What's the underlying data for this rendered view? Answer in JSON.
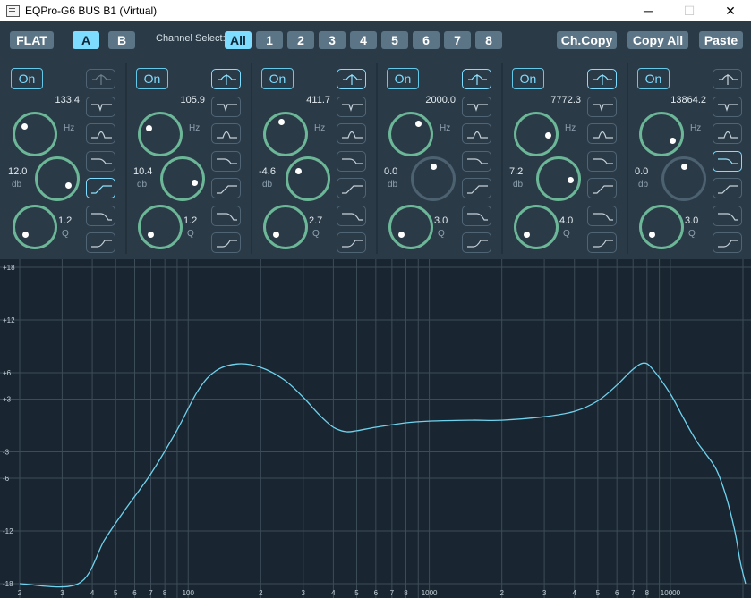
{
  "window": {
    "title": "EQPro-G6 BUS B1 (Virtual)",
    "minimize": "─",
    "maximize": "☐",
    "close": "✕"
  },
  "toolbar": {
    "flat": "FLAT",
    "a": "A",
    "b": "B",
    "channel_select_label": "Channel Select:",
    "channels": [
      "All",
      "1",
      "2",
      "3",
      "4",
      "5",
      "6",
      "7",
      "8"
    ],
    "selected_channel": "All",
    "selected_preset": "A",
    "ch_copy": "Ch.Copy",
    "copy_all": "Copy All",
    "paste": "Paste"
  },
  "bands": [
    {
      "on": "On",
      "freq": "133.4",
      "freq_unit": "Hz",
      "gain": "12.0",
      "gain_unit": "db",
      "q": "1.2",
      "q_unit": "Q",
      "type": "high-shelf",
      "gain_active": true
    },
    {
      "on": "On",
      "freq": "105.9",
      "freq_unit": "Hz",
      "gain": "10.4",
      "gain_unit": "db",
      "q": "1.2",
      "q_unit": "Q",
      "type": "peak",
      "gain_active": true
    },
    {
      "on": "On",
      "freq": "411.7",
      "freq_unit": "Hz",
      "gain": "-4.6",
      "gain_unit": "db",
      "q": "2.7",
      "q_unit": "Q",
      "type": "peak",
      "gain_active": true
    },
    {
      "on": "On",
      "freq": "2000.0",
      "freq_unit": "Hz",
      "gain": "0.0",
      "gain_unit": "db",
      "q": "3.0",
      "q_unit": "Q",
      "type": "peak",
      "gain_active": false
    },
    {
      "on": "On",
      "freq": "7772.3",
      "freq_unit": "Hz",
      "gain": "7.2",
      "gain_unit": "db",
      "q": "4.0",
      "q_unit": "Q",
      "type": "peak",
      "gain_active": true
    },
    {
      "on": "On",
      "freq": "13864.2",
      "freq_unit": "Hz",
      "gain": "0.0",
      "gain_unit": "db",
      "q": "3.0",
      "q_unit": "Q",
      "type": "low-pass",
      "gain_active": false
    }
  ],
  "filter_shapes": [
    "peak-icon",
    "notch-icon",
    "bandpass-icon",
    "high-cut-icon",
    "low-shelf-icon",
    "high-shelf-icon",
    "low-cut-icon"
  ],
  "graph": {
    "y_labels": [
      "+18",
      "+12",
      "+6",
      "+3",
      "-3",
      "-6",
      "-12",
      "-18"
    ],
    "x_labels": [
      "2",
      "3",
      "4",
      "5",
      "6",
      "7",
      "8",
      "100",
      "2",
      "3",
      "4",
      "5",
      "6",
      "7",
      "8",
      "1000",
      "2",
      "3",
      "4",
      "5",
      "6",
      "7",
      "8",
      "10000"
    ],
    "curve_color": "#6fd3ee",
    "grid_color": "#3d4c58",
    "response_db": [
      [
        20,
        -18
      ],
      [
        35,
        -18
      ],
      [
        45,
        -13
      ],
      [
        55,
        -9.5
      ],
      [
        70,
        -5.5
      ],
      [
        90,
        -0.5
      ],
      [
        110,
        4.0
      ],
      [
        130,
        6.2
      ],
      [
        160,
        7.0
      ],
      [
        200,
        6.6
      ],
      [
        250,
        5.2
      ],
      [
        300,
        3.2
      ],
      [
        350,
        1.2
      ],
      [
        400,
        -0.2
      ],
      [
        450,
        -0.7
      ],
      [
        500,
        -0.6
      ],
      [
        600,
        -0.2
      ],
      [
        800,
        0.3
      ],
      [
        1000,
        0.5
      ],
      [
        1500,
        0.6
      ],
      [
        2000,
        0.6
      ],
      [
        3000,
        1.0
      ],
      [
        4000,
        1.6
      ],
      [
        5000,
        2.8
      ],
      [
        6000,
        4.6
      ],
      [
        7000,
        6.4
      ],
      [
        7800,
        7.1
      ],
      [
        8500,
        6.3
      ],
      [
        10000,
        3.6
      ],
      [
        11000,
        1.5
      ],
      [
        12000,
        -0.4
      ],
      [
        13000,
        -2.0
      ],
      [
        14000,
        -3.2
      ],
      [
        15500,
        -5.0
      ],
      [
        17000,
        -8.0
      ],
      [
        18500,
        -12.0
      ],
      [
        19500,
        -15.5
      ],
      [
        20500,
        -18
      ]
    ]
  }
}
